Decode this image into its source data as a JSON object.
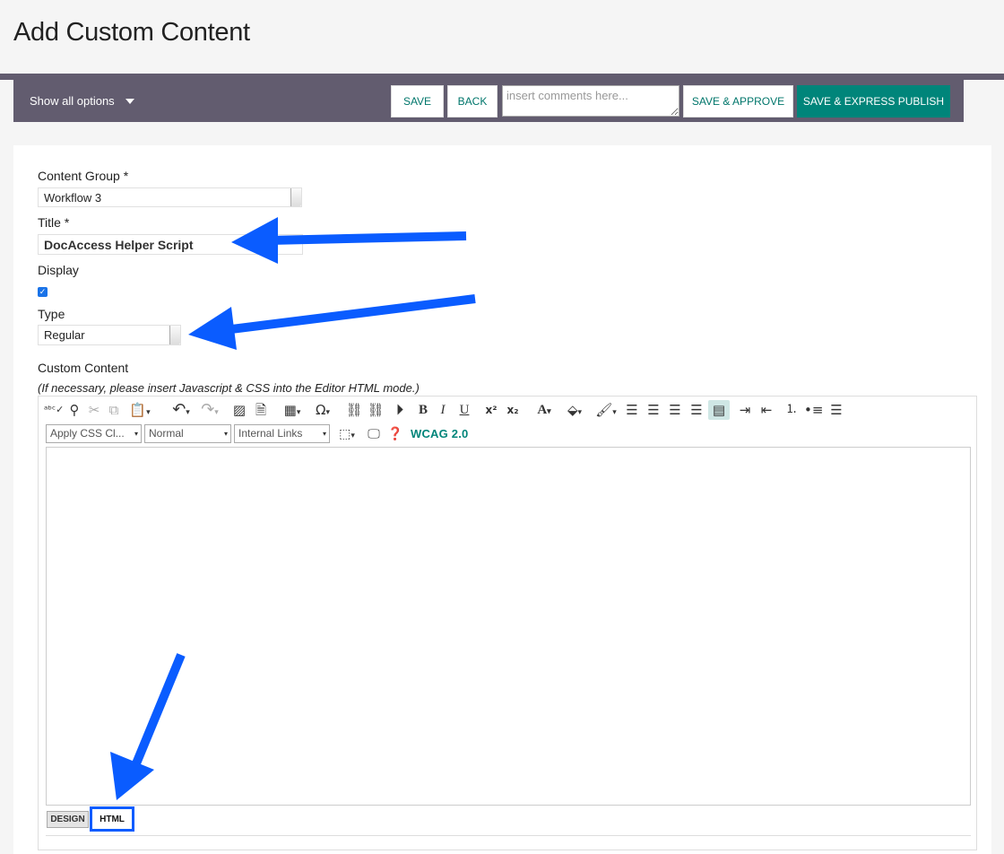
{
  "page": {
    "title": "Add Custom Content"
  },
  "toolbar": {
    "show_options_label": "Show all options",
    "save_label": "SAVE",
    "back_label": "BACK",
    "comments_placeholder": "insert comments here...",
    "save_approve_label": "SAVE & APPROVE",
    "save_publish_label": "SAVE & EXPRESS PUBLISH"
  },
  "form": {
    "content_group": {
      "label": "Content Group *",
      "value": "Workflow 3"
    },
    "title": {
      "label": "Title *",
      "value": "DocAccess Helper Script"
    },
    "display": {
      "label": "Display",
      "checked": true
    },
    "type": {
      "label": "Type",
      "value": "Regular"
    },
    "custom_content": {
      "label": "Custom Content",
      "hint": "(If necessary, please insert Javascript & CSS into the Editor HTML mode.)"
    }
  },
  "editor": {
    "css_class_select": "Apply CSS Cl...",
    "format_select": "Normal",
    "links_select": "Internal Links",
    "wcag_label": "WCAG 2.0",
    "mode_tabs": {
      "design": "DESIGN",
      "html": "HTML"
    },
    "tools": [
      "spellcheck-icon",
      "find-icon",
      "cut-icon",
      "copy-icon",
      "paste-icon",
      "undo-icon",
      "redo-icon",
      "image-icon",
      "document-icon",
      "table-icon",
      "omega-icon",
      "link-icon",
      "unlink-icon",
      "media-icon",
      "bold-icon",
      "italic-icon",
      "underline-icon",
      "superscript-icon",
      "subscript-icon",
      "font-color-icon",
      "highlight-icon",
      "format-stripper-icon",
      "align-left-icon",
      "align-center-icon",
      "align-right-icon",
      "justify-icon",
      "no-align-icon",
      "indent-icon",
      "outdent-icon",
      "numbered-list-icon",
      "bullet-list-icon",
      "paragraph-icon",
      "module-icon",
      "preview-icon",
      "help-icon"
    ]
  },
  "colors": {
    "accent": "#00857a",
    "toolbar_bg": "#625c6f",
    "annotation_arrow": "#0a5cff"
  }
}
